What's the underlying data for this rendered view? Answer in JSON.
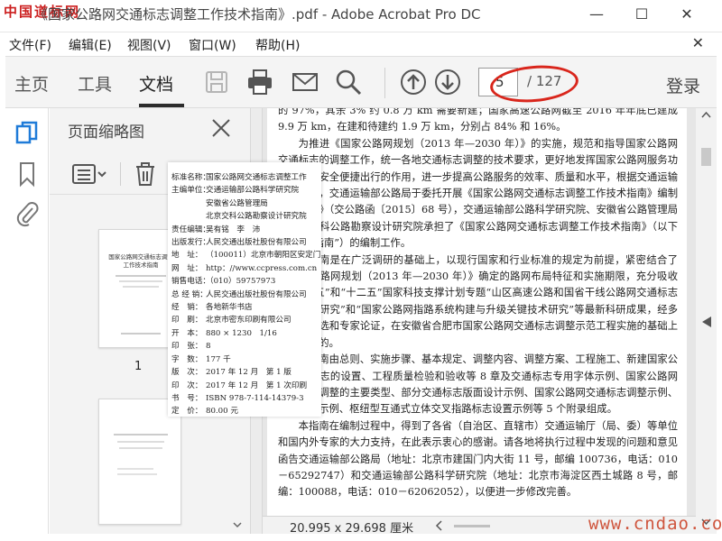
{
  "window": {
    "watermark": "中国道标网",
    "title": "《国家公路网交通标志调整工作技术指南》.pdf - Adobe Acrobat Pro DC"
  },
  "menu": {
    "items": [
      "文件(F)",
      "编辑(E)",
      "视图(V)",
      "窗口(W)",
      "帮助(H)"
    ]
  },
  "toolbar": {
    "tabs": [
      "主页",
      "工具",
      "文档"
    ],
    "active_tab": "文档",
    "current_page": "5",
    "total_pages": "/ 127",
    "login_label": "登录",
    "icons": [
      "save-icon",
      "print-icon",
      "email-icon",
      "search-icon",
      "page-up-icon",
      "page-down-icon"
    ]
  },
  "thumbnails": {
    "title": "页面缩略图",
    "page_number": "1",
    "cover_title_lines": [
      "国家公路网交通标志调整",
      "工作技术指南"
    ]
  },
  "overlay": {
    "rows": [
      {
        "k": "标准名称：",
        "v": "国家公路网交通标志调整工作"
      },
      {
        "k": "主编单位：",
        "v": "交通运输部公路科学研究院"
      },
      {
        "k": "",
        "v": "安徽省公路管理局"
      },
      {
        "k": "",
        "v": "北京交科公路勘察设计研究院"
      },
      {
        "k": "责任编辑：",
        "v": "吴有铭　李　沛"
      },
      {
        "k": "出版发行：",
        "v": "人民交通出版社股份有限公司"
      },
      {
        "k": "地　址：",
        "v": "（100011）北京市朝阳区安定门"
      },
      {
        "k": "网　址：",
        "v": "http：//www.ccpress.com.cn"
      },
      {
        "k": "销售电话：",
        "v": "（010）59757973"
      },
      {
        "k": "总 经 销：",
        "v": "人民交通出版社股份有限公司"
      },
      {
        "k": "经　销：",
        "v": "各地新华书店"
      },
      {
        "k": "印　刷：",
        "v": "北京市密东印刷有限公司"
      },
      {
        "k": "开　本：",
        "v": "880 × 1230　1/16"
      },
      {
        "k": "印　张：",
        "v": "8"
      },
      {
        "k": "字　数：",
        "v": "177 千"
      },
      {
        "k": "版　次：",
        "v": "2017 年 12 月　第 1 版"
      },
      {
        "k": "印　次：",
        "v": "2017 年 12 月　第 1 次印刷"
      },
      {
        "k": "书　号：",
        "v": "ISBN 978-7-114-14379-3"
      },
      {
        "k": "定　价：",
        "v": "80.00 元"
      }
    ]
  },
  "document": {
    "paragraphs": [
      {
        "indent": false,
        "text": "的 97%，其余 3% 约 0.8 万 km 需要新建；国家高速公路网截至 2016 年年底已建成 9.9 万 km，在建和待建约 1.9 万 km，分别占 84% 和 16%。"
      },
      {
        "indent": true,
        "text": "为推进《国家公路网规划（2013 年—2030 年）》的实施，规范和指导国家公路网交通标志的调整工作，统一各地交通标志调整的技术要求，更好地发挥国家公路网服务功能，保障安全便捷出行的作用，进一步提高公路服务的效率、质量和水平，根据交通运输部的要求，交通运输部公路局于委托开展《国家公路网交通标志调整工作技术指南》编制工作的函》（交公路函〔2015〕68 号），交通运输部公路科学研究院、安徽省公路管理局和北京交科公路勘察设计研究院承担了《国家公路网交通标志调整工作技术指南》（以下简称“本指南”）的编制工作。"
      },
      {
        "indent": true,
        "text": "本指南是在广泛调研的基础上，以现行国家和行业标准的规定为前提，紧密结合了《国家公路网规划（2013 年—2030 年）》确定的路网布局特征和实施期限，充分吸收了“十一五”和“十二五”国家科技支撑计划专题“山区高速公路和国省干线公路网交通标志关键技术研究”和“国家公路网指路系统构建与升级关键技术研究”等最新科研成果，经多次方案比选和专家论证，在安徽省合肥市国家公路网交通标志调整示范工程实施的基础上编制而成的。"
      },
      {
        "indent": true,
        "text": "本指南由总则、实施步骤、基本规定、调整内容、调整方案、工程施工、新建国家公路交通标志的设置、工程质量检验和验收等 8 章及交通标志专用字体示例、国家公路网交通标志调整的主要类型、部分交通标志版面设计示例、国家公路网交通标志调整示例、标志设计示例、枢纽型互通式立体交叉指路标志设置示例等 5 个附录组成。"
      },
      {
        "indent": true,
        "text": "本指南在编制过程中，得到了各省（自治区、直辖市）交通运输厅（局、委）等单位和国内外专家的大力支持，在此表示衷心的感谢。请各地将执行过程中发现的问题和意见函告交通运输部公路局（地址：北京市建国门内大街 11 号，邮编 100736，电话：010－65292747）和交通运输部公路科学研究院（地址：北京市海淀区西土城路 8 号，邮编：100088，电话：010－62062052），以便进一步修改完善。"
      }
    ]
  },
  "status": {
    "page_size": "20.995 x 29.698 厘米",
    "watermark": "www.cndao.com"
  }
}
